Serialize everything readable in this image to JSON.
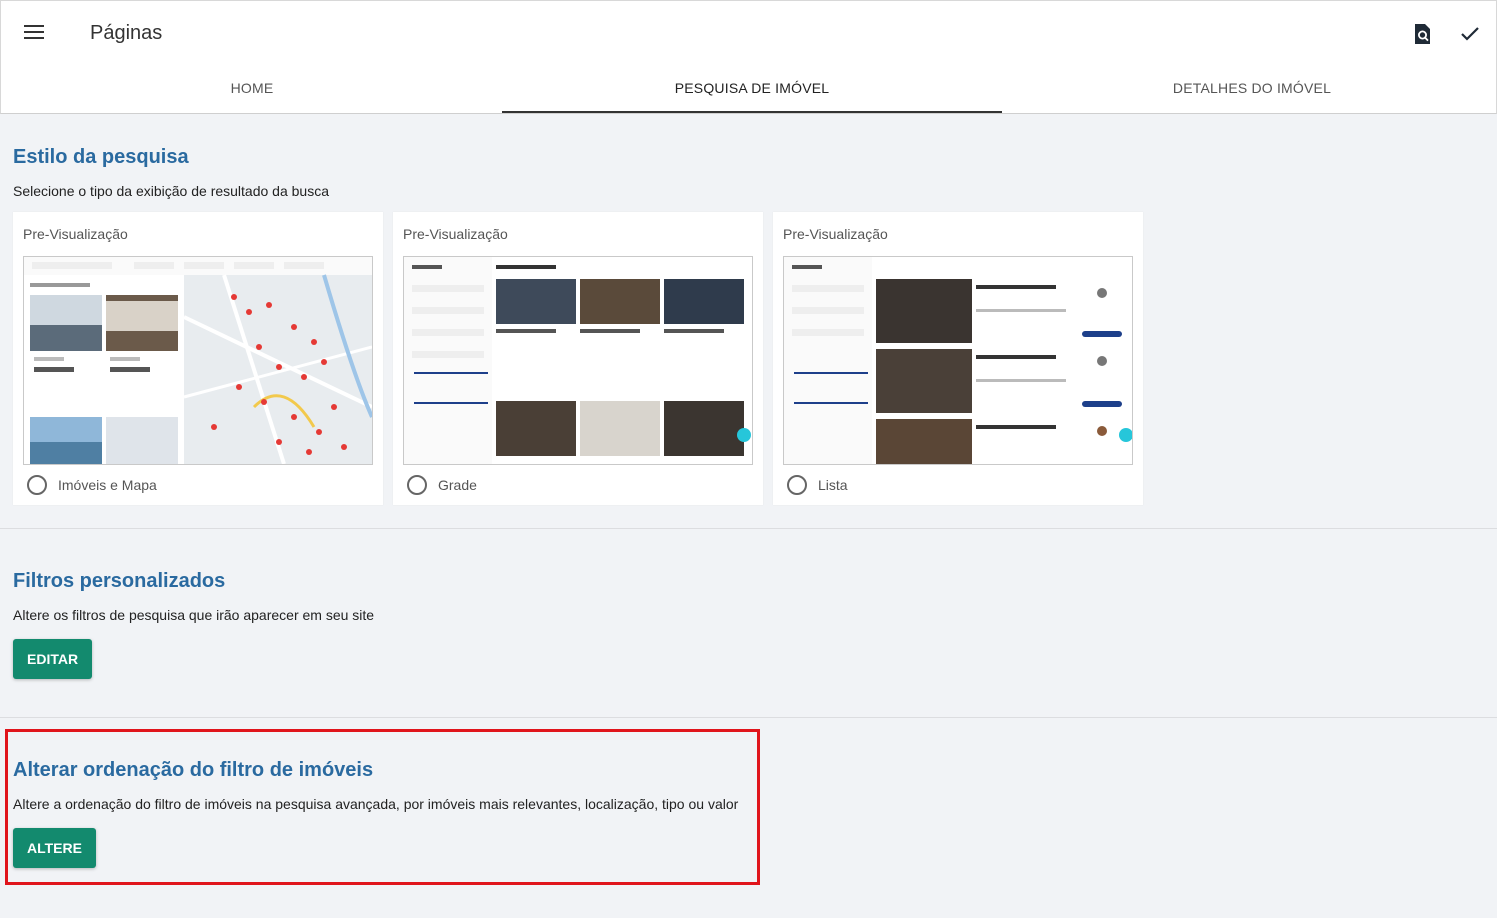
{
  "appbar": {
    "title": "Páginas",
    "menu_icon": "hamburger-icon",
    "preview_icon": "search-document-icon",
    "save_icon": "check-icon"
  },
  "tabs": [
    {
      "label": "HOME",
      "active": false
    },
    {
      "label": "PESQUISA DE IMÓVEL",
      "active": true
    },
    {
      "label": "DETALHES DO IMÓVEL",
      "active": false
    }
  ],
  "search_style": {
    "title": "Estilo da pesquisa",
    "description": "Selecione o tipo da exibição de resultado da busca",
    "cards": [
      {
        "preview_label": "Pre-Visualização",
        "option_label": "Imóveis e Mapa",
        "selected": false
      },
      {
        "preview_label": "Pre-Visualização",
        "option_label": "Grade",
        "selected": false
      },
      {
        "preview_label": "Pre-Visualização",
        "option_label": "Lista",
        "selected": false
      }
    ]
  },
  "custom_filters": {
    "title": "Filtros personalizados",
    "description": "Altere os filtros de pesquisa que irão aparecer em seu site",
    "button_label": "EDITAR"
  },
  "sort_order": {
    "title": "Alterar ordenação do filtro de imóveis",
    "description": "Altere a ordenação do filtro de imóveis na pesquisa avançada, por imóveis mais relevantes, localização, tipo ou valor",
    "button_label": "ALTERE"
  },
  "colors": {
    "accent": "#138a6e",
    "title_blue": "#2a6aa0",
    "highlight": "#e0141b"
  }
}
